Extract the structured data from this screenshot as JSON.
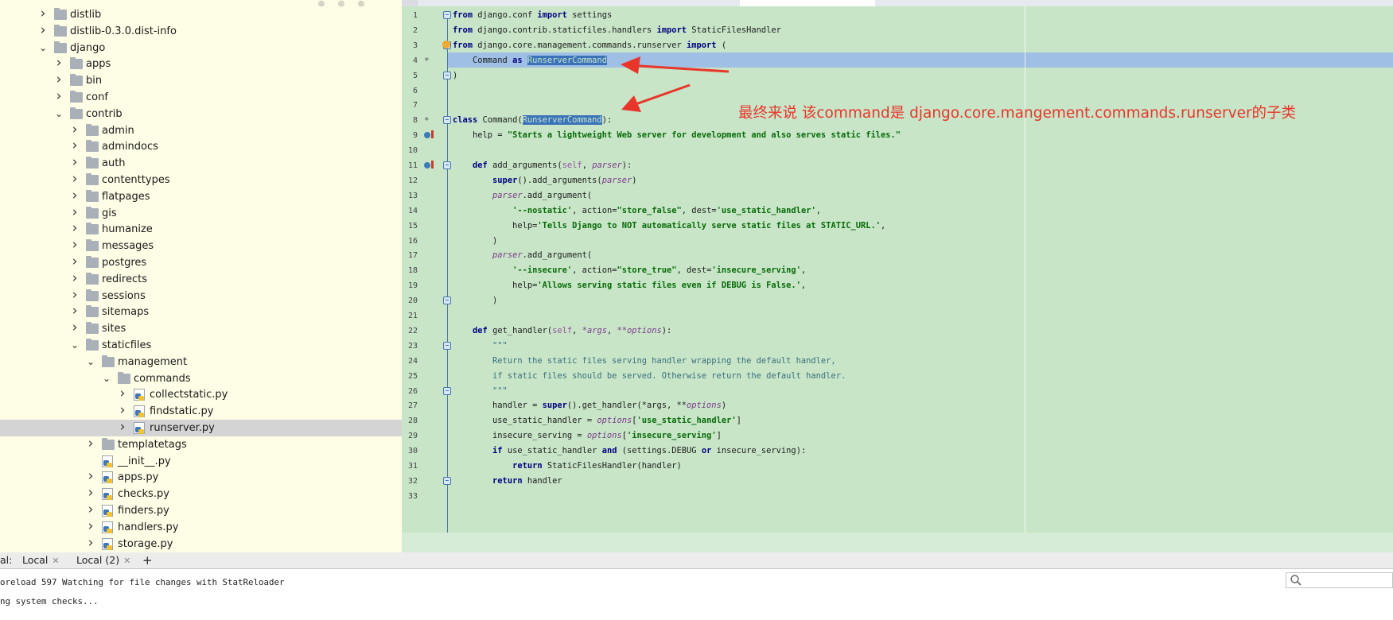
{
  "project_tree": {
    "items": [
      {
        "label": "distlib",
        "type": "folder",
        "expanded": false
      },
      {
        "label": "distlib-0.3.0.dist-info",
        "type": "folder",
        "expanded": false
      },
      {
        "label": "django",
        "type": "folder",
        "expanded": true
      },
      {
        "label": "apps",
        "type": "folder",
        "expanded": false
      },
      {
        "label": "bin",
        "type": "folder",
        "expanded": false
      },
      {
        "label": "conf",
        "type": "folder",
        "expanded": false
      },
      {
        "label": "contrib",
        "type": "folder",
        "expanded": true
      },
      {
        "label": "admin",
        "type": "folder",
        "expanded": false
      },
      {
        "label": "admindocs",
        "type": "folder",
        "expanded": false
      },
      {
        "label": "auth",
        "type": "folder",
        "expanded": false
      },
      {
        "label": "contenttypes",
        "type": "folder",
        "expanded": false
      },
      {
        "label": "flatpages",
        "type": "folder",
        "expanded": false
      },
      {
        "label": "gis",
        "type": "folder",
        "expanded": false
      },
      {
        "label": "humanize",
        "type": "folder",
        "expanded": false
      },
      {
        "label": "messages",
        "type": "folder",
        "expanded": false
      },
      {
        "label": "postgres",
        "type": "folder",
        "expanded": false
      },
      {
        "label": "redirects",
        "type": "folder",
        "expanded": false
      },
      {
        "label": "sessions",
        "type": "folder",
        "expanded": false
      },
      {
        "label": "sitemaps",
        "type": "folder",
        "expanded": false
      },
      {
        "label": "sites",
        "type": "folder",
        "expanded": false
      },
      {
        "label": "staticfiles",
        "type": "folder",
        "expanded": true
      },
      {
        "label": "management",
        "type": "folder",
        "expanded": true
      },
      {
        "label": "commands",
        "type": "folder",
        "expanded": true
      },
      {
        "label": "collectstatic.py",
        "type": "file",
        "expanded": false
      },
      {
        "label": "findstatic.py",
        "type": "file",
        "expanded": false
      },
      {
        "label": "runserver.py",
        "type": "file",
        "expanded": false,
        "selected": true
      },
      {
        "label": "templatetags",
        "type": "folder",
        "expanded": false
      },
      {
        "label": "__init__.py",
        "type": "file",
        "expanded": false
      },
      {
        "label": "apps.py",
        "type": "file",
        "expanded": false
      },
      {
        "label": "checks.py",
        "type": "file",
        "expanded": false
      },
      {
        "label": "finders.py",
        "type": "file",
        "expanded": false
      },
      {
        "label": "handlers.py",
        "type": "file",
        "expanded": false
      },
      {
        "label": "storage.py",
        "type": "file",
        "expanded": false
      }
    ]
  },
  "annotation": {
    "text": "最终来说 该command是 django.core.mangement.commands.runserver的子类",
    "color": "#e8362a"
  },
  "terminal": {
    "prefix": "al:",
    "tabs": [
      {
        "label": "Local"
      },
      {
        "label": "Local (2)"
      }
    ],
    "add_label": "+",
    "lines": [
      "oreload 597 Watching for file changes with StatReloader",
      "ng system checks..."
    ]
  },
  "colors": {
    "editor_bg": "#c8e5c8",
    "sidebar_bg": "#fefde6",
    "selection": "#3b73b9",
    "annotation": "#e8362a"
  }
}
